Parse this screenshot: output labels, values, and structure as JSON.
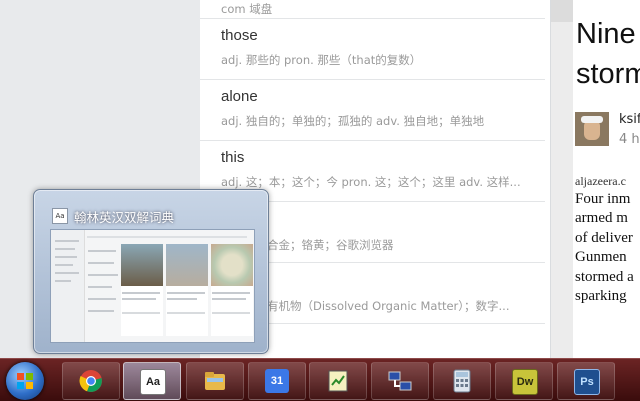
{
  "dictionary": {
    "partial_top_def": "com 域盘",
    "entries": [
      {
        "word": "those",
        "definition": "adj. 那些的 pron. 那些（that的复数）"
      },
      {
        "word": "alone",
        "definition": "adj. 独自的；单独的；孤独的 adv. 独自地；单独地"
      },
      {
        "word": "this",
        "definition": "adj. 这；本；这个；今 pron. 这；这个；这里 adv. 这样..."
      }
    ],
    "hidden_rows": [
      "合金；铬黄；谷歌浏览器",
      "有机物（Dissolved Organic Matter）；数字..."
    ]
  },
  "article": {
    "title_line1": "Nine",
    "title_line2": "storm",
    "author": "ksif",
    "time": "4 h",
    "source": "aljazeera.c",
    "body_lines": [
      "Four inm",
      "armed m",
      "of deliver",
      "Gunmen",
      "stormed a",
      "sparking"
    ]
  },
  "thumbnail": {
    "app_icon_text": "Aa",
    "title": "翰林英汉双解词典"
  },
  "taskbar": {
    "items": [
      {
        "name": "chrome",
        "icon": "chrome-icon",
        "active": false
      },
      {
        "name": "dictionary",
        "icon": "dictionary-icon",
        "label": "Aa",
        "active": true
      },
      {
        "name": "explorer",
        "icon": "folder-icon",
        "active": false
      },
      {
        "name": "calendar",
        "icon": "calendar-icon",
        "label": "31",
        "active": false
      },
      {
        "name": "notepad",
        "icon": "notepad-icon",
        "active": false
      },
      {
        "name": "network",
        "icon": "network-icon",
        "active": false
      },
      {
        "name": "calculator",
        "icon": "calculator-icon",
        "active": false
      },
      {
        "name": "dreamweaver",
        "icon": "dreamweaver-icon",
        "label": "Dw",
        "active": false
      },
      {
        "name": "photoshop",
        "icon": "photoshop-icon",
        "label": "Ps",
        "active": false
      }
    ]
  },
  "colors": {
    "taskbar": "#5a1a1a",
    "dw": "#c8c43a",
    "ps": "#1f4f8f",
    "article_link": "#c0392b"
  }
}
